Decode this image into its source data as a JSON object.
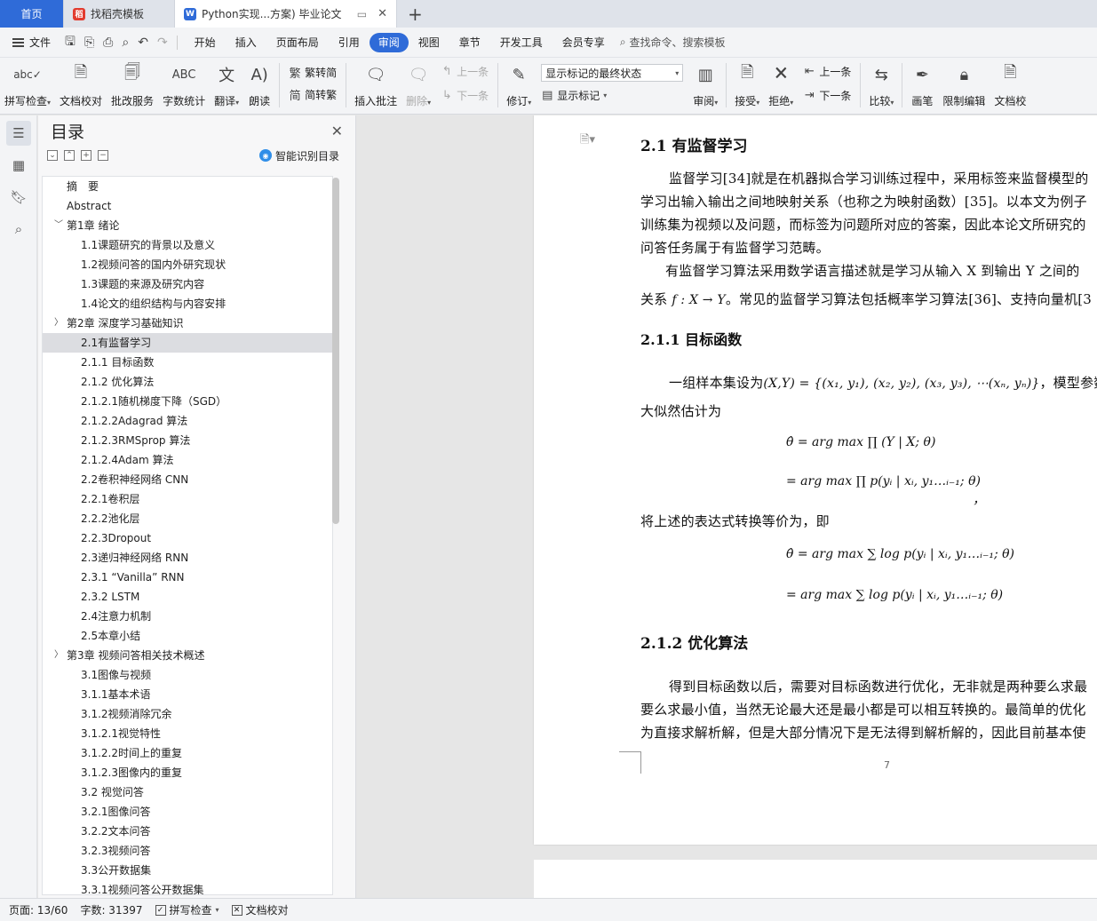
{
  "tabs": {
    "home": "首页",
    "docer": "找稻壳模板",
    "doc": "Python实现...方案) 毕业论文"
  },
  "menubar": {
    "file": "文件",
    "items": [
      "开始",
      "插入",
      "页面布局",
      "引用",
      "审阅",
      "视图",
      "章节",
      "开发工具",
      "会员专享"
    ],
    "active_index": 4,
    "search": "查找命令、搜索模板"
  },
  "toolbar": {
    "spellcheck": "拼写检查",
    "proofread": "文档校对",
    "batch": "批改服务",
    "wordcount": "字数统计",
    "translate": "翻译",
    "read": "朗读",
    "trad_to_simp": "繁转简",
    "simp_to_trad": "简转繁",
    "insert_comment": "插入批注",
    "delete": "删除",
    "prev": "上一条",
    "next": "下一条",
    "revise": "修订",
    "markup_select": "显示标记的最终状态",
    "show_markup": "显示标记",
    "review": "审阅",
    "accept": "接受",
    "reject": "拒绝",
    "prev2": "上一条",
    "next2": "下一条",
    "compare": "比较",
    "pen": "画笔",
    "restrict": "限制编辑",
    "docsave": "文档校"
  },
  "toc": {
    "title": "目录",
    "smart": "智能识别目录",
    "items": [
      {
        "t": "摘　要",
        "lv": 1
      },
      {
        "t": "Abstract",
        "lv": 1
      },
      {
        "t": "第1章  绪论",
        "lv": 1,
        "chev": "﹀"
      },
      {
        "t": "1.1课题研究的背景以及意义",
        "lv": 2
      },
      {
        "t": "1.2视频问答的国内外研究现状",
        "lv": 2
      },
      {
        "t": "1.3课题的来源及研究内容",
        "lv": 2
      },
      {
        "t": "1.4论文的组织结构与内容安排",
        "lv": 2
      },
      {
        "t": "第2章  深度学习基础知识",
        "lv": 1,
        "chev": "〉"
      },
      {
        "t": "2.1有监督学习",
        "lv": 2,
        "sel": true
      },
      {
        "t": "2.1.1  目标函数",
        "lv": 2
      },
      {
        "t": "2.1.2  优化算法",
        "lv": 2
      },
      {
        "t": "2.1.2.1随机梯度下降（SGD）",
        "lv": 2
      },
      {
        "t": "2.1.2.2Adagrad 算法",
        "lv": 2
      },
      {
        "t": "2.1.2.3RMSprop 算法",
        "lv": 2
      },
      {
        "t": "2.1.2.4Adam 算法",
        "lv": 2
      },
      {
        "t": "2.2卷积神经网络  CNN",
        "lv": 2
      },
      {
        "t": "2.2.1卷积层",
        "lv": 2
      },
      {
        "t": "2.2.2池化层",
        "lv": 2
      },
      {
        "t": "2.2.3Dropout",
        "lv": 2
      },
      {
        "t": "2.3递归神经网络  RNN",
        "lv": 2
      },
      {
        "t": "2.3.1  “Vanilla” RNN",
        "lv": 2
      },
      {
        "t": "2.3.2  LSTM",
        "lv": 2
      },
      {
        "t": "2.4注意力机制",
        "lv": 2
      },
      {
        "t": "2.5本章小结",
        "lv": 2
      },
      {
        "t": "第3章  视频问答相关技术概述",
        "lv": 1,
        "chev": "〉"
      },
      {
        "t": "3.1图像与视频",
        "lv": 2
      },
      {
        "t": "3.1.1基本术语",
        "lv": 2
      },
      {
        "t": "3.1.2视频消除冗余",
        "lv": 2
      },
      {
        "t": "3.1.2.1视觉特性",
        "lv": 2
      },
      {
        "t": "3.1.2.2时间上的重复",
        "lv": 2
      },
      {
        "t": "3.1.2.3图像内的重复",
        "lv": 2
      },
      {
        "t": "3.2  视觉问答",
        "lv": 2
      },
      {
        "t": "3.2.1图像问答",
        "lv": 2
      },
      {
        "t": "3.2.2文本问答",
        "lv": 2
      },
      {
        "t": "3.2.3视频问答",
        "lv": 2
      },
      {
        "t": "3.3公开数据集",
        "lv": 2
      },
      {
        "t": "3.3.1视频问答公开数据集",
        "lv": 2
      }
    ]
  },
  "doc": {
    "h_2_1": "2.1   有监督学习",
    "p1": "监督学习[34]就是在机器拟合学习训练过程中，采用标签来监督模型的",
    "p2": "学习出输入输出之间地映射关系（也称之为映射函数）[35]。以本文为例子",
    "p3": "训练集为视频以及问题，而标签为问题所对应的答案，因此本论文所研究的",
    "p4": "问答任务属于有监督学习范畴。",
    "p5": "有监督学习算法采用数学语言描述就是学习从输入 X 到输出 Y 之间的",
    "p6a": "关系",
    "p6eq": "f : X → Y",
    "p6b": "。常见的监督学习算法包括概率学习算法[36]、支持向量机[3",
    "h_2_1_1": "2.1.1      目标函数",
    "p7a": "一组样本集设为",
    "p7eq": "(X,Y) = {(x₁, y₁), (x₂, y₂), (x₃, y₃), ⋯(xₙ, yₙ)}",
    "p7b": "，模型参数 θ",
    "p8": "大似然估计为",
    "eq1": "θ̂ = arg max ∏ (Y | X; θ)",
    "eq2": "= arg max ∏ p(yᵢ | xᵢ, y₁…ᵢ₋₁; θ)",
    "eq2_comma": "，",
    "p9": "将上述的表达式转换等价为，即",
    "eq3": "θ̂ = arg max ∑ log p(yᵢ | xᵢ, y₁…ᵢ₋₁; θ)",
    "eq4": "= arg max ∑ log p(yᵢ | xᵢ, y₁…ᵢ₋₁; θ)",
    "h_2_1_2": "2.1.2    优化算法",
    "p10": "得到目标函数以后，需要对目标函数进行优化，无非就是两种要么求最",
    "p11": "要么求最小值，当然无论最大还是最小都是可以相互转换的。最简单的优化",
    "p12": "为直接求解析解，但是大部分情况下是无法得到解析解的，因此目前基本使",
    "page_number": "7"
  },
  "status": {
    "page": "页面: 13/60",
    "words": "字数: 31397",
    "spell": "拼写检查",
    "proof": "文档校对"
  }
}
